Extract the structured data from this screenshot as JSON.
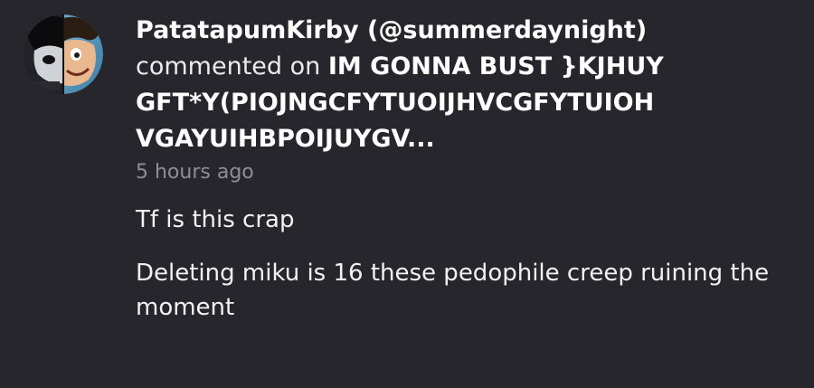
{
  "comment": {
    "author": "PatatapumKirby (@summerdaynight)",
    "verb": "commented on",
    "post_title_lines": [
      "IM GONNA BUST }KJHUY",
      "GFT*Y(PIOJNGCFYTUOIJHVCGFYTUIOH",
      "VGAYUIHBPOIJUYGV..."
    ],
    "timestamp": "5 hours ago",
    "body": [
      "Tf is this crap",
      "Deleting miku is 16 these pedophile creep ruining the moment"
    ]
  },
  "colors": {
    "background": "#27262c",
    "text": "#ffffff",
    "timestamp": "#8f8e96"
  },
  "icons": {
    "avatar": "profile-avatar-half-face"
  }
}
